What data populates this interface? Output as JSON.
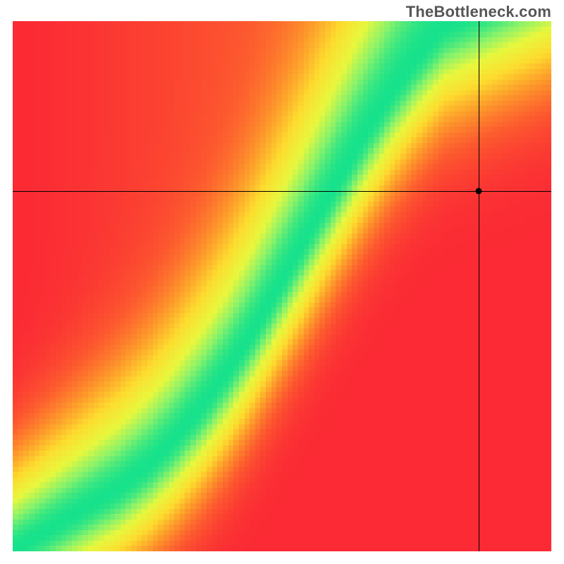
{
  "watermark": "TheBottleneck.com",
  "chart_data": {
    "type": "heatmap",
    "title": "",
    "xlabel": "",
    "ylabel": "",
    "xrange": [
      0,
      100
    ],
    "yrange": [
      0,
      100
    ],
    "xlim": [
      0,
      100
    ],
    "ylim": [
      0,
      100
    ],
    "green_ridge": {
      "description": "Optimal balance curve (green band) y as function of x",
      "points_x": [
        0,
        5,
        10,
        15,
        20,
        25,
        30,
        35,
        40,
        45,
        50,
        55,
        60,
        65,
        70,
        75,
        80,
        82
      ],
      "points_y": [
        0,
        3,
        6,
        9,
        12,
        16,
        21,
        27,
        34,
        42,
        51,
        60,
        69,
        78,
        86,
        93,
        99,
        100
      ],
      "band_width": 6
    },
    "corners": {
      "top_left": "red",
      "bottom_left": "red",
      "bottom_right": "red",
      "top_right": "yellow-orange",
      "ridge": "green"
    },
    "gradient_stops": [
      {
        "t": 0.0,
        "color": "#fb2a35"
      },
      {
        "t": 0.2,
        "color": "#fd5b2f"
      },
      {
        "t": 0.4,
        "color": "#fd9a2b"
      },
      {
        "t": 0.6,
        "color": "#fddc2f"
      },
      {
        "t": 0.78,
        "color": "#e8f83e"
      },
      {
        "t": 0.9,
        "color": "#8cf36a"
      },
      {
        "t": 1.0,
        "color": "#17e28c"
      }
    ],
    "crosshair": {
      "x": 86.5,
      "y": 68
    },
    "marker": {
      "x": 86.5,
      "y": 68
    },
    "grid_resolution": 100
  }
}
